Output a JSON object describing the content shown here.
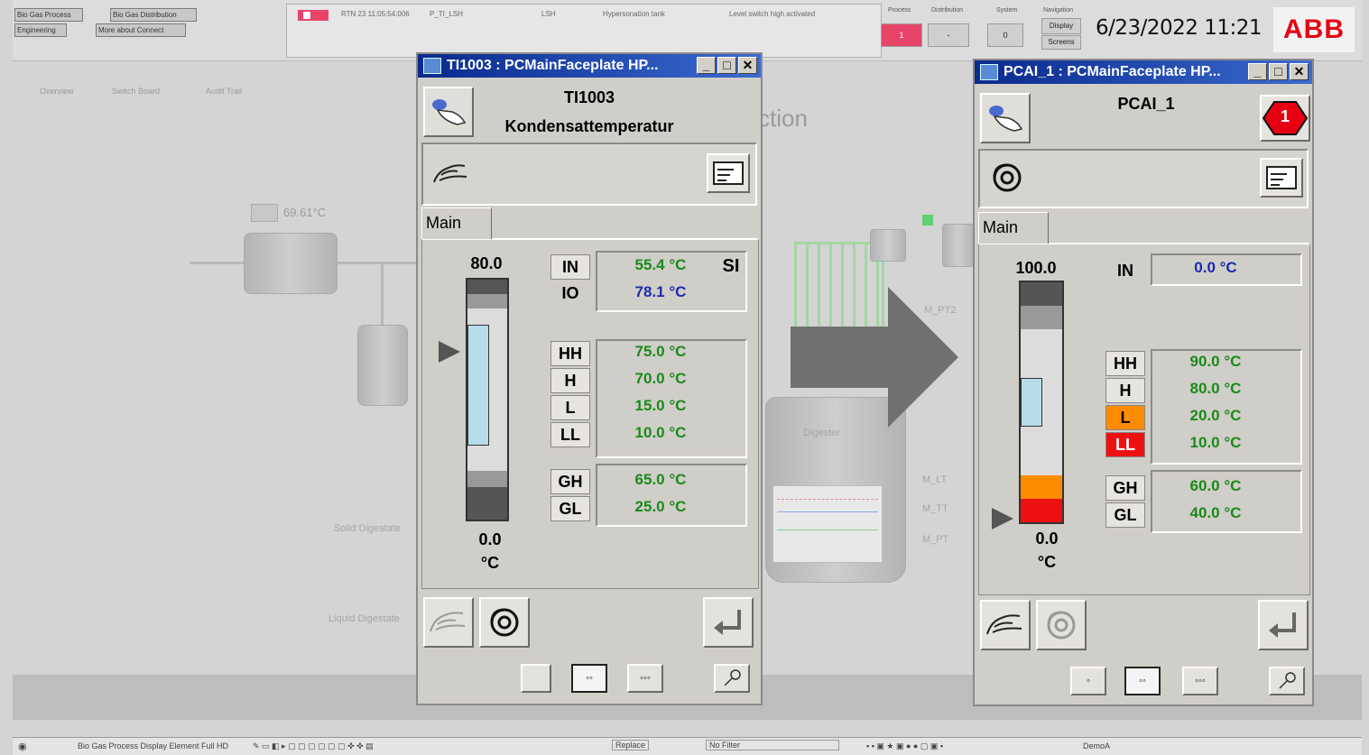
{
  "topbar": {
    "nav_buttons": [
      "Bio Gas Process",
      "Bio Gas Distribution",
      "Engineering",
      "More about Connect"
    ],
    "alarm": {
      "time": "RTN 23 11:05:54:006",
      "tag": "P_TI_LSH",
      "cond": "LSH",
      "object": "Hypersonation tank",
      "message": "Level switch high activated"
    },
    "column_headers": [
      "Process",
      "Distribution",
      "System",
      "Navigation"
    ],
    "process_count": "1",
    "distribution_count": "-",
    "system_count": "0",
    "nav_display": "Display",
    "nav_screens": "Screens",
    "datetime": "6/23/2022 11:21",
    "logo": "ABB"
  },
  "process": {
    "tabs": [
      "Overview",
      "Switch Board",
      "Audit Trail"
    ],
    "temp_reading": "69.61°C",
    "section_title": "ction",
    "labels": [
      "Solid Digestate",
      "Liquid Digestate",
      "Digester",
      "M_PT2",
      "M_LT",
      "M_TT",
      "M_PT"
    ]
  },
  "faceplate_left": {
    "window_title": "TI1003 : PCMainFaceplate HP...",
    "tag": "TI1003",
    "description": "Kondensattemperatur",
    "tab_main": "Main",
    "scale_max": "80.0",
    "scale_min": "0.0",
    "unit": "°C",
    "in_label": "IN",
    "io_label": "IO",
    "in_value": "55.4 °C",
    "io_value": "78.1 °C",
    "si_badge": "SI",
    "limits": [
      {
        "label": "HH",
        "value": "75.0 °C"
      },
      {
        "label": "H",
        "value": "70.0 °C"
      },
      {
        "label": "L",
        "value": "15.0 °C"
      },
      {
        "label": "LL",
        "value": "10.0 °C"
      }
    ],
    "gradients": [
      {
        "label": "GH",
        "value": "65.0 °C"
      },
      {
        "label": "GL",
        "value": "25.0 °C"
      }
    ],
    "nav_small": [
      "◦◦",
      "◦◦◦"
    ]
  },
  "faceplate_right": {
    "window_title": "PCAI_1 : PCMainFaceplate HP...",
    "tag": "PCAI_1",
    "alarm_count": "1",
    "tab_main": "Main",
    "scale_max": "100.0",
    "scale_min": "0.0",
    "unit": "°C",
    "in_label": "IN",
    "in_value": "0.0 °C",
    "limits": [
      {
        "label": "HH",
        "value": "90.0 °C"
      },
      {
        "label": "H",
        "value": "80.0 °C"
      },
      {
        "label": "L",
        "value": "20.0 °C"
      },
      {
        "label": "LL",
        "value": "10.0 °C"
      }
    ],
    "gradients": [
      {
        "label": "GH",
        "value": "60.0 °C"
      },
      {
        "label": "GL",
        "value": "40.0 °C"
      }
    ],
    "nav_small": [
      "◦",
      "◦◦",
      "◦◦◦"
    ]
  },
  "taskbar": {
    "display_element": "Bio Gas Process Display Element Full HD",
    "replace": "Replace",
    "filter": "No Filter",
    "user": "DemoA"
  },
  "colors": {
    "alarm_red": "#e60012",
    "limit_orange": "#ff8c00",
    "limit_red": "#ee1111",
    "value_green": "#1a8a1a",
    "value_blue": "#1a2ab0"
  }
}
